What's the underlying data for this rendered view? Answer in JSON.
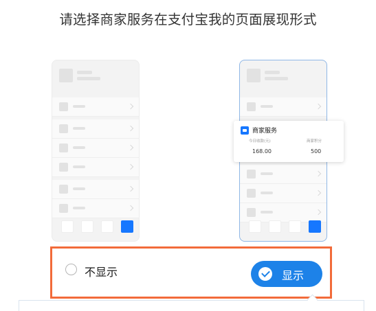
{
  "title": "请选择商家服务在支付宝我的页面展现形式",
  "popup": {
    "title": "商家服务",
    "label_left": "今日收款(元)",
    "value_left": "168.00",
    "label_right": "商家积分",
    "value_right": "500"
  },
  "options": {
    "hide_label": "不显示",
    "show_label": "显示",
    "selected": "显示"
  },
  "colors": {
    "accent": "#1d82e8",
    "highlight_border": "#f26b3a"
  },
  "icons": [
    "merchant-service-icon",
    "checkmark-icon"
  ]
}
